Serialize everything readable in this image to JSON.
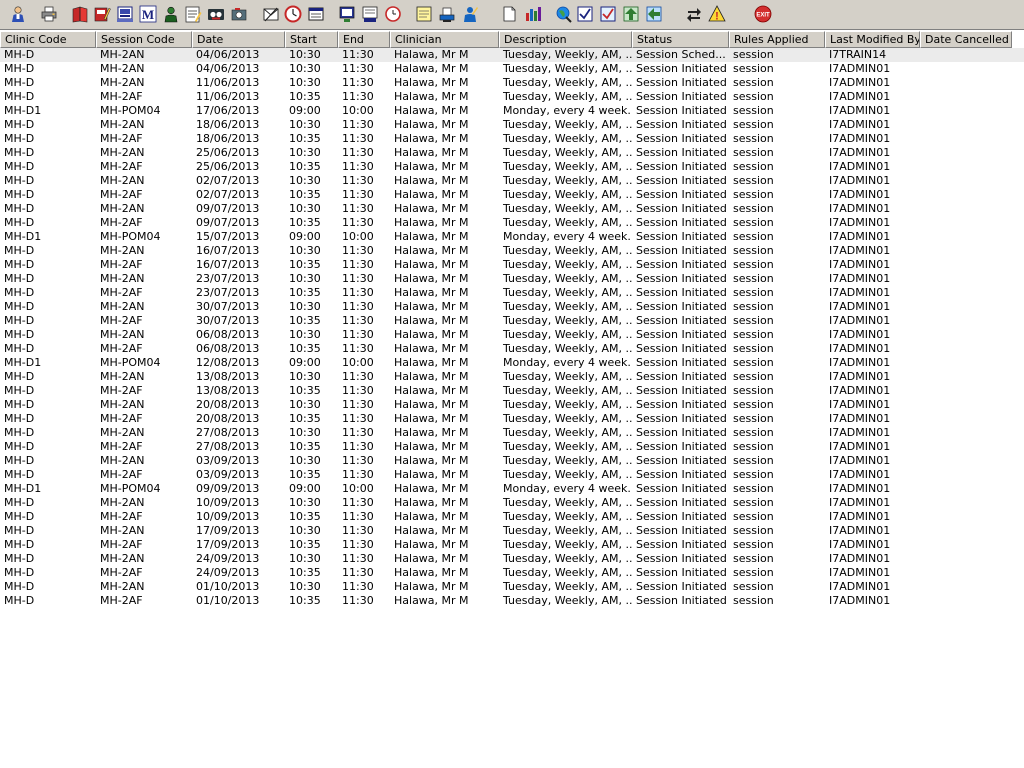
{
  "toolbar": {
    "buttons": [
      {
        "icon": "person-icon"
      },
      {
        "icon": "printer-icon"
      },
      {
        "icon": "book-icon"
      },
      {
        "icon": "notebook-edit-icon"
      },
      {
        "icon": "keyboard-icon"
      },
      {
        "icon": "letter-m-icon",
        "label": "M"
      },
      {
        "icon": "user-card-icon"
      },
      {
        "icon": "notes-icon"
      },
      {
        "icon": "tape-icon"
      },
      {
        "icon": "camera-icon"
      },
      {
        "icon": "envelope-pencil-icon"
      },
      {
        "icon": "no-entry-icon"
      },
      {
        "icon": "window-icon"
      },
      {
        "icon": "screen-icon"
      },
      {
        "icon": "document-list-icon"
      },
      {
        "icon": "clock-icon"
      },
      {
        "icon": "yellow-document-icon"
      },
      {
        "icon": "hat-icon"
      },
      {
        "icon": "person-blue-icon"
      },
      {
        "icon": "blank-page-icon"
      },
      {
        "icon": "bar-chart-icon"
      },
      {
        "icon": "globe-search-icon"
      },
      {
        "icon": "check-document-icon"
      },
      {
        "icon": "check-document-alt-icon"
      },
      {
        "icon": "green-arrow-icon"
      },
      {
        "icon": "green-arrow-alt-icon"
      },
      {
        "icon": "transfer-icon"
      },
      {
        "icon": "warning-icon",
        "label": "!"
      },
      {
        "icon": "exit-icon",
        "label": "EXIT"
      }
    ]
  },
  "columns": [
    "Clinic Code",
    "Session Code",
    "Date",
    "Start",
    "End",
    "Clinician",
    "Description",
    "Status",
    "Rules Applied",
    "Last Modified By",
    "Date Cancelled"
  ],
  "rows": [
    [
      "MH-D",
      "MH-2AN",
      "04/06/2013",
      "10:30",
      "11:30",
      "Halawa, Mr M",
      "Tuesday, Weekly, AM, ...",
      "Session Sched...",
      "session",
      "I7TRAIN14",
      ""
    ],
    [
      "MH-D",
      "MH-2AN",
      "04/06/2013",
      "10:30",
      "11:30",
      "Halawa, Mr M",
      "Tuesday, Weekly, AM, ...",
      "Session Initiated",
      "session",
      "I7ADMIN01",
      ""
    ],
    [
      "MH-D",
      "MH-2AN",
      "11/06/2013",
      "10:30",
      "11:30",
      "Halawa, Mr M",
      "Tuesday, Weekly, AM, ...",
      "Session Initiated",
      "session",
      "I7ADMIN01",
      ""
    ],
    [
      "MH-D",
      "MH-2AF",
      "11/06/2013",
      "10:35",
      "11:30",
      "Halawa, Mr M",
      "Tuesday, Weekly, AM, ...",
      "Session Initiated",
      "session",
      "I7ADMIN01",
      ""
    ],
    [
      "MH-D1",
      "MH-POM04",
      "17/06/2013",
      "09:00",
      "10:00",
      "Halawa, Mr M",
      "Monday, every 4 week...",
      "Session Initiated",
      "session",
      "I7ADMIN01",
      ""
    ],
    [
      "MH-D",
      "MH-2AN",
      "18/06/2013",
      "10:30",
      "11:30",
      "Halawa, Mr M",
      "Tuesday, Weekly, AM, ...",
      "Session Initiated",
      "session",
      "I7ADMIN01",
      ""
    ],
    [
      "MH-D",
      "MH-2AF",
      "18/06/2013",
      "10:35",
      "11:30",
      "Halawa, Mr M",
      "Tuesday, Weekly, AM, ...",
      "Session Initiated",
      "session",
      "I7ADMIN01",
      ""
    ],
    [
      "MH-D",
      "MH-2AN",
      "25/06/2013",
      "10:30",
      "11:30",
      "Halawa, Mr M",
      "Tuesday, Weekly, AM, ...",
      "Session Initiated",
      "session",
      "I7ADMIN01",
      ""
    ],
    [
      "MH-D",
      "MH-2AF",
      "25/06/2013",
      "10:35",
      "11:30",
      "Halawa, Mr M",
      "Tuesday, Weekly, AM, ...",
      "Session Initiated",
      "session",
      "I7ADMIN01",
      ""
    ],
    [
      "MH-D",
      "MH-2AN",
      "02/07/2013",
      "10:30",
      "11:30",
      "Halawa, Mr M",
      "Tuesday, Weekly, AM, ...",
      "Session Initiated",
      "session",
      "I7ADMIN01",
      ""
    ],
    [
      "MH-D",
      "MH-2AF",
      "02/07/2013",
      "10:35",
      "11:30",
      "Halawa, Mr M",
      "Tuesday, Weekly, AM, ...",
      "Session Initiated",
      "session",
      "I7ADMIN01",
      ""
    ],
    [
      "MH-D",
      "MH-2AN",
      "09/07/2013",
      "10:30",
      "11:30",
      "Halawa, Mr M",
      "Tuesday, Weekly, AM, ...",
      "Session Initiated",
      "session",
      "I7ADMIN01",
      ""
    ],
    [
      "MH-D",
      "MH-2AF",
      "09/07/2013",
      "10:35",
      "11:30",
      "Halawa, Mr M",
      "Tuesday, Weekly, AM, ...",
      "Session Initiated",
      "session",
      "I7ADMIN01",
      ""
    ],
    [
      "MH-D1",
      "MH-POM04",
      "15/07/2013",
      "09:00",
      "10:00",
      "Halawa, Mr M",
      "Monday, every 4 week...",
      "Session Initiated",
      "session",
      "I7ADMIN01",
      ""
    ],
    [
      "MH-D",
      "MH-2AN",
      "16/07/2013",
      "10:30",
      "11:30",
      "Halawa, Mr M",
      "Tuesday, Weekly, AM, ...",
      "Session Initiated",
      "session",
      "I7ADMIN01",
      ""
    ],
    [
      "MH-D",
      "MH-2AF",
      "16/07/2013",
      "10:35",
      "11:30",
      "Halawa, Mr M",
      "Tuesday, Weekly, AM, ...",
      "Session Initiated",
      "session",
      "I7ADMIN01",
      ""
    ],
    [
      "MH-D",
      "MH-2AN",
      "23/07/2013",
      "10:30",
      "11:30",
      "Halawa, Mr M",
      "Tuesday, Weekly, AM, ...",
      "Session Initiated",
      "session",
      "I7ADMIN01",
      ""
    ],
    [
      "MH-D",
      "MH-2AF",
      "23/07/2013",
      "10:35",
      "11:30",
      "Halawa, Mr M",
      "Tuesday, Weekly, AM, ...",
      "Session Initiated",
      "session",
      "I7ADMIN01",
      ""
    ],
    [
      "MH-D",
      "MH-2AN",
      "30/07/2013",
      "10:30",
      "11:30",
      "Halawa, Mr M",
      "Tuesday, Weekly, AM, ...",
      "Session Initiated",
      "session",
      "I7ADMIN01",
      ""
    ],
    [
      "MH-D",
      "MH-2AF",
      "30/07/2013",
      "10:35",
      "11:30",
      "Halawa, Mr M",
      "Tuesday, Weekly, AM, ...",
      "Session Initiated",
      "session",
      "I7ADMIN01",
      ""
    ],
    [
      "MH-D",
      "MH-2AN",
      "06/08/2013",
      "10:30",
      "11:30",
      "Halawa, Mr M",
      "Tuesday, Weekly, AM, ...",
      "Session Initiated",
      "session",
      "I7ADMIN01",
      ""
    ],
    [
      "MH-D",
      "MH-2AF",
      "06/08/2013",
      "10:35",
      "11:30",
      "Halawa, Mr M",
      "Tuesday, Weekly, AM, ...",
      "Session Initiated",
      "session",
      "I7ADMIN01",
      ""
    ],
    [
      "MH-D1",
      "MH-POM04",
      "12/08/2013",
      "09:00",
      "10:00",
      "Halawa, Mr M",
      "Monday, every 4 week...",
      "Session Initiated",
      "session",
      "I7ADMIN01",
      ""
    ],
    [
      "MH-D",
      "MH-2AN",
      "13/08/2013",
      "10:30",
      "11:30",
      "Halawa, Mr M",
      "Tuesday, Weekly, AM, ...",
      "Session Initiated",
      "session",
      "I7ADMIN01",
      ""
    ],
    [
      "MH-D",
      "MH-2AF",
      "13/08/2013",
      "10:35",
      "11:30",
      "Halawa, Mr M",
      "Tuesday, Weekly, AM, ...",
      "Session Initiated",
      "session",
      "I7ADMIN01",
      ""
    ],
    [
      "MH-D",
      "MH-2AN",
      "20/08/2013",
      "10:30",
      "11:30",
      "Halawa, Mr M",
      "Tuesday, Weekly, AM, ...",
      "Session Initiated",
      "session",
      "I7ADMIN01",
      ""
    ],
    [
      "MH-D",
      "MH-2AF",
      "20/08/2013",
      "10:35",
      "11:30",
      "Halawa, Mr M",
      "Tuesday, Weekly, AM, ...",
      "Session Initiated",
      "session",
      "I7ADMIN01",
      ""
    ],
    [
      "MH-D",
      "MH-2AN",
      "27/08/2013",
      "10:30",
      "11:30",
      "Halawa, Mr M",
      "Tuesday, Weekly, AM, ...",
      "Session Initiated",
      "session",
      "I7ADMIN01",
      ""
    ],
    [
      "MH-D",
      "MH-2AF",
      "27/08/2013",
      "10:35",
      "11:30",
      "Halawa, Mr M",
      "Tuesday, Weekly, AM, ...",
      "Session Initiated",
      "session",
      "I7ADMIN01",
      ""
    ],
    [
      "MH-D",
      "MH-2AN",
      "03/09/2013",
      "10:30",
      "11:30",
      "Halawa, Mr M",
      "Tuesday, Weekly, AM, ...",
      "Session Initiated",
      "session",
      "I7ADMIN01",
      ""
    ],
    [
      "MH-D",
      "MH-2AF",
      "03/09/2013",
      "10:35",
      "11:30",
      "Halawa, Mr M",
      "Tuesday, Weekly, AM, ...",
      "Session Initiated",
      "session",
      "I7ADMIN01",
      ""
    ],
    [
      "MH-D1",
      "MH-POM04",
      "09/09/2013",
      "09:00",
      "10:00",
      "Halawa, Mr M",
      "Monday, every 4 week...",
      "Session Initiated",
      "session",
      "I7ADMIN01",
      ""
    ],
    [
      "MH-D",
      "MH-2AN",
      "10/09/2013",
      "10:30",
      "11:30",
      "Halawa, Mr M",
      "Tuesday, Weekly, AM, ...",
      "Session Initiated",
      "session",
      "I7ADMIN01",
      ""
    ],
    [
      "MH-D",
      "MH-2AF",
      "10/09/2013",
      "10:35",
      "11:30",
      "Halawa, Mr M",
      "Tuesday, Weekly, AM, ...",
      "Session Initiated",
      "session",
      "I7ADMIN01",
      ""
    ],
    [
      "MH-D",
      "MH-2AN",
      "17/09/2013",
      "10:30",
      "11:30",
      "Halawa, Mr M",
      "Tuesday, Weekly, AM, ...",
      "Session Initiated",
      "session",
      "I7ADMIN01",
      ""
    ],
    [
      "MH-D",
      "MH-2AF",
      "17/09/2013",
      "10:35",
      "11:30",
      "Halawa, Mr M",
      "Tuesday, Weekly, AM, ...",
      "Session Initiated",
      "session",
      "I7ADMIN01",
      ""
    ],
    [
      "MH-D",
      "MH-2AN",
      "24/09/2013",
      "10:30",
      "11:30",
      "Halawa, Mr M",
      "Tuesday, Weekly, AM, ...",
      "Session Initiated",
      "session",
      "I7ADMIN01",
      ""
    ],
    [
      "MH-D",
      "MH-2AF",
      "24/09/2013",
      "10:35",
      "11:30",
      "Halawa, Mr M",
      "Tuesday, Weekly, AM, ...",
      "Session Initiated",
      "session",
      "I7ADMIN01",
      ""
    ],
    [
      "MH-D",
      "MH-2AN",
      "01/10/2013",
      "10:30",
      "11:30",
      "Halawa, Mr M",
      "Tuesday, Weekly, AM, ...",
      "Session Initiated",
      "session",
      "I7ADMIN01",
      ""
    ],
    [
      "MH-D",
      "MH-2AF",
      "01/10/2013",
      "10:35",
      "11:30",
      "Halawa, Mr M",
      "Tuesday, Weekly, AM, ...",
      "Session Initiated",
      "session",
      "I7ADMIN01",
      ""
    ]
  ]
}
